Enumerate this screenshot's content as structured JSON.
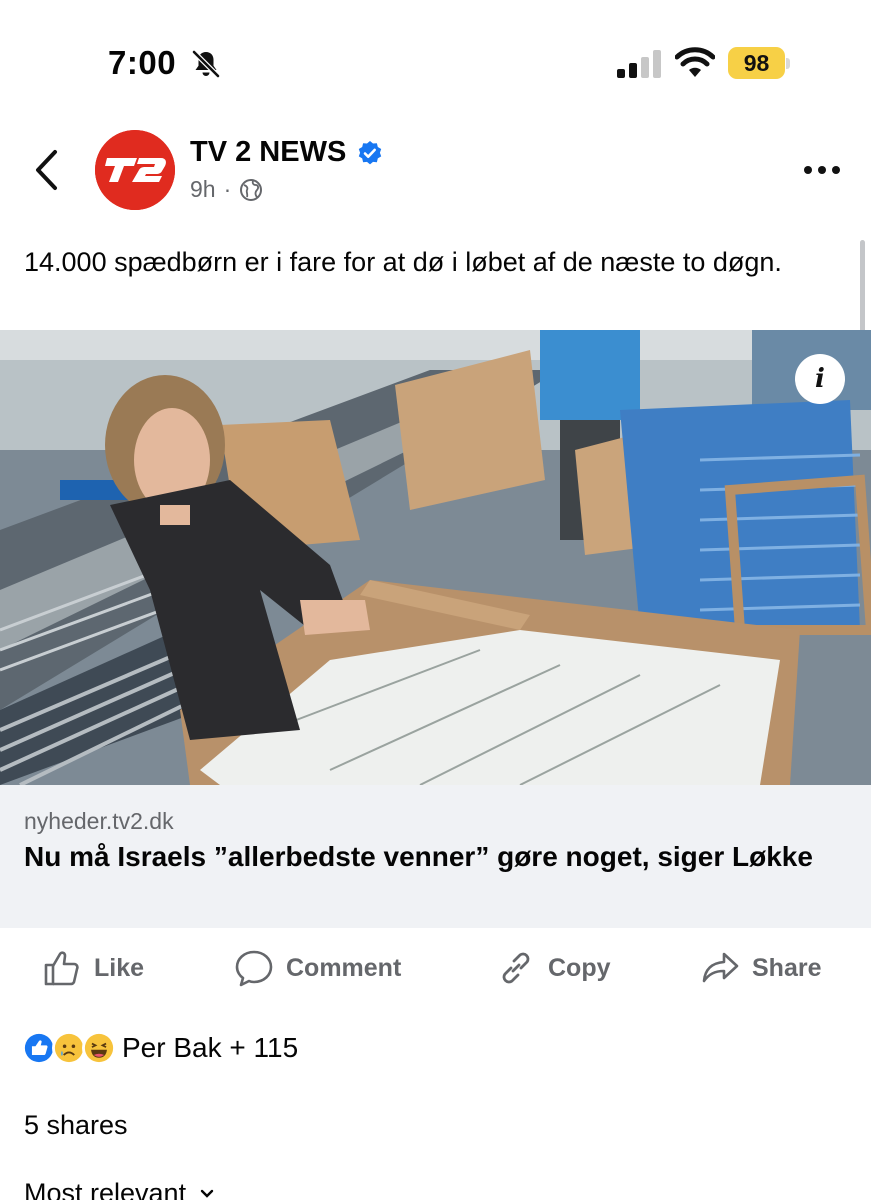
{
  "status_bar": {
    "time": "7:00",
    "battery": "98"
  },
  "post": {
    "page_name": "TV 2 NEWS",
    "time_ago": "9h",
    "separator": "·",
    "text": "14.000 spædbørn er i fare for at dø i løbet af de næste to døgn."
  },
  "link": {
    "domain": "nyheder.tv2.dk",
    "title": "Nu må Israels ”allerbedste venner” gøre noget, siger Løkke"
  },
  "photo": {
    "info_label": "i"
  },
  "actions": {
    "like": "Like",
    "comment": "Comment",
    "copy": "Copy",
    "share": "Share"
  },
  "reactions": {
    "text": "Per Bak + 115"
  },
  "shares": "5 shares",
  "sort": "Most relevant",
  "colors": {
    "brand_red": "#e02b1f",
    "verified_blue": "#1877f2",
    "battery_yellow": "#f7d046",
    "muted_text": "#65676b"
  }
}
